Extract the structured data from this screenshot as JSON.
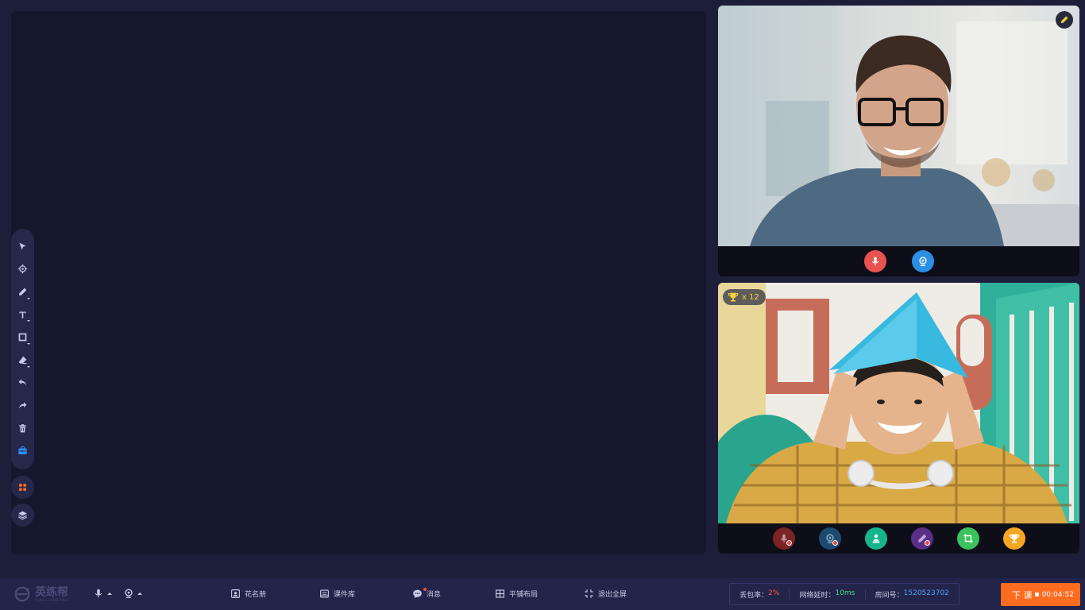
{
  "toolbar": {
    "tools": [
      "select-icon",
      "laser-pointer-icon",
      "pen-icon",
      "text-icon",
      "shape-icon",
      "eraser-icon",
      "undo-icon",
      "redo-icon",
      "delete-icon",
      "toolbox-icon"
    ],
    "extra": [
      "apps-icon",
      "layers-icon"
    ]
  },
  "teacher": {
    "controls": [
      "microphone-icon",
      "camera-icon"
    ]
  },
  "student": {
    "trophy_count": "x 12",
    "controls": [
      "microphone-muted-icon",
      "camera-muted-icon",
      "stage-icon",
      "pen-disabled-icon",
      "crop-icon",
      "trophy-icon"
    ]
  },
  "bottombar": {
    "logo_text": "英练帮",
    "logo_sub": "YINGLIANBANG",
    "nav": {
      "roster": "花名册",
      "courseware": "课件库",
      "messages": "消息",
      "tile_layout": "平铺布局",
      "exit_fullscreen": "退出全屏"
    },
    "stats": {
      "packet_loss_label": "丢包率：",
      "packet_loss_value": "2%",
      "latency_label": "网络延时：",
      "latency_value": "10ms",
      "room_label": "房间号：",
      "room_value": "1520523702"
    },
    "end_class": {
      "label": "下 课",
      "timer": "00:04:52"
    }
  },
  "colors": {
    "accent_orange": "#ff6b1f",
    "red": "#ff5a4f",
    "green": "#3ddc84",
    "blue": "#4aa3ff",
    "background": "#1d1e3a"
  }
}
